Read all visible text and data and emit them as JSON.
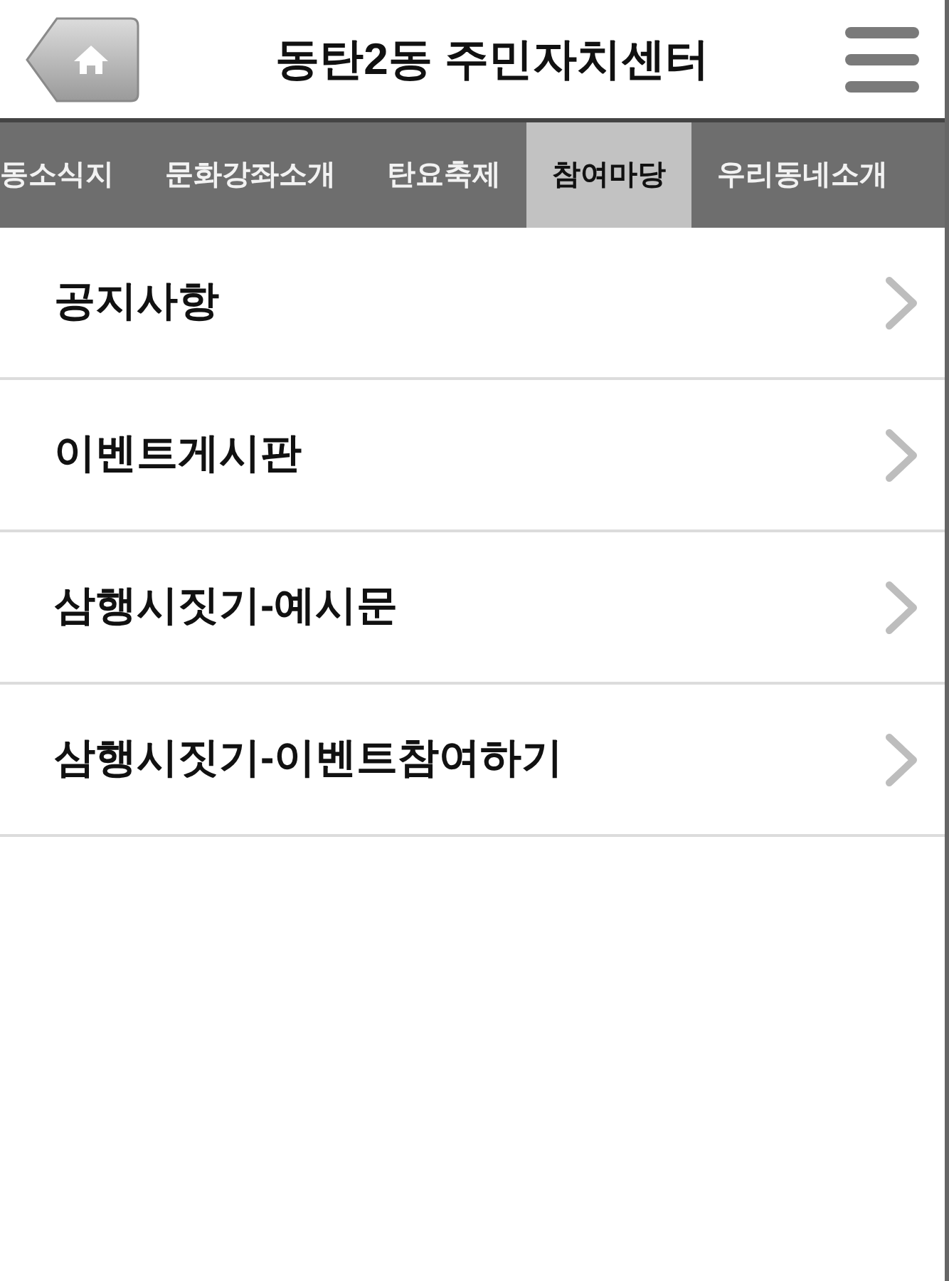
{
  "header": {
    "title": "동탄2동 주민자치센터"
  },
  "tabs": [
    {
      "label": "동소식지",
      "selected": false
    },
    {
      "label": "문화강좌소개",
      "selected": false
    },
    {
      "label": "탄요축제",
      "selected": false
    },
    {
      "label": "참여마당",
      "selected": true
    },
    {
      "label": "우리동네소개",
      "selected": false
    }
  ],
  "menu_items": [
    {
      "label": "공지사항"
    },
    {
      "label": "이벤트게시판"
    },
    {
      "label": "삼행시짓기-예시문"
    },
    {
      "label": "삼행시짓기-이벤트참여하기"
    }
  ]
}
